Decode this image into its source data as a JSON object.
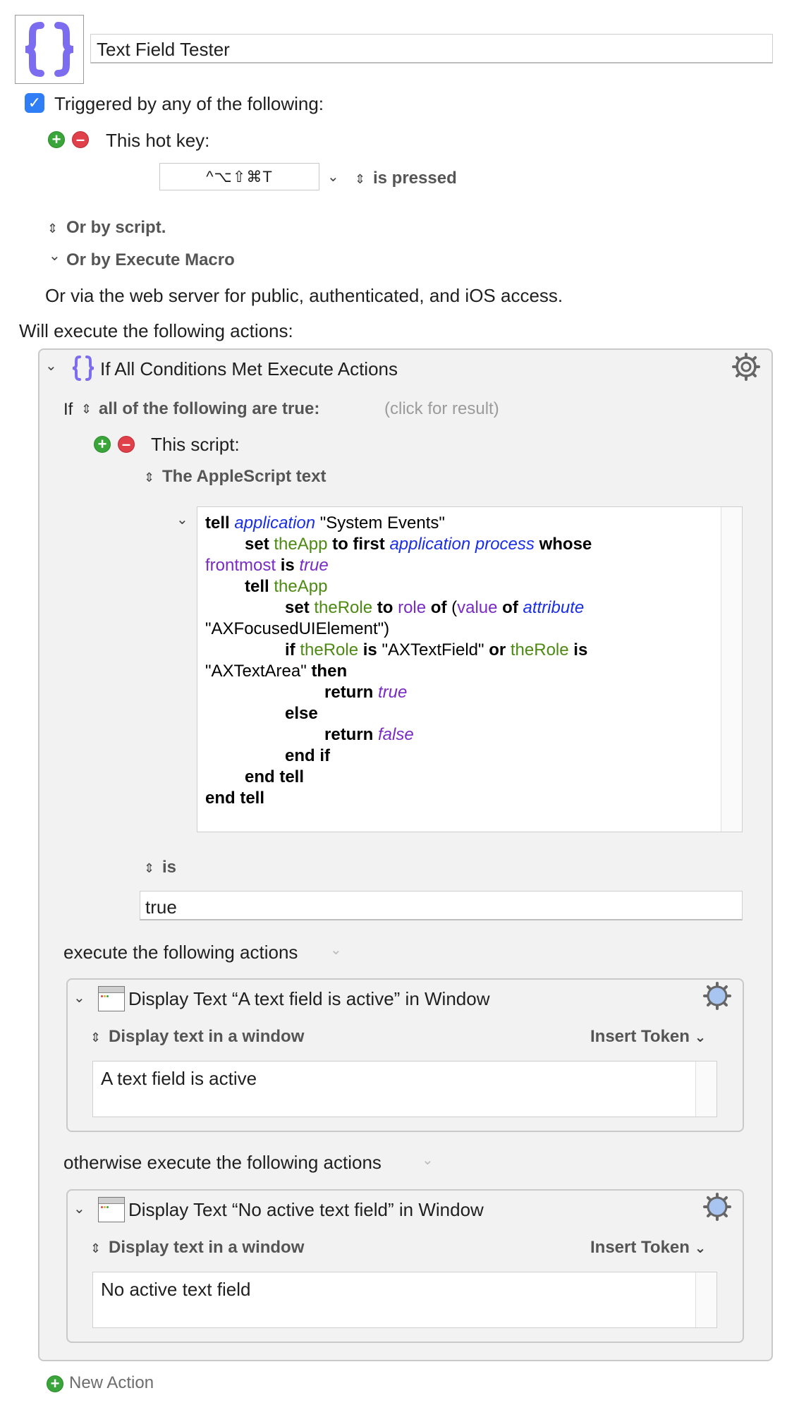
{
  "macro": {
    "title": "Text Field Tester",
    "icon": "curly-braces-icon"
  },
  "triggers": {
    "checkbox_label": "Triggered by any of the following:",
    "hotkey_label": "This hot key:",
    "hotkey_value": "^⌥⇧⌘T",
    "hotkey_condition": "is pressed",
    "or_by_script": "Or by script.",
    "or_by_execute_macro": "Or by Execute Macro",
    "web_server_note": "Or via the web server for public, authenticated, and iOS access."
  },
  "actions_header": "Will execute the following actions:",
  "if_action": {
    "title": "If All Conditions Met Execute Actions",
    "if_word": "If",
    "condition_mode": "all of the following are true:",
    "click_for_result": "(click for result)",
    "condition_label": "This script:",
    "script_type": "The AppleScript text",
    "comparison": "is",
    "comparison_value": "true",
    "then_label": "execute the following actions",
    "else_label": "otherwise execute the following actions"
  },
  "script": {
    "l1": [
      "tell",
      "application",
      "\"System Events\""
    ],
    "l2": [
      "set",
      "theApp",
      "to first",
      "application process",
      "whose"
    ],
    "l3": [
      "frontmost",
      "is",
      "true"
    ],
    "l4": [
      "tell",
      "theApp"
    ],
    "l5": [
      "set",
      "theRole",
      "to",
      "role",
      "of",
      "(",
      "value",
      "of",
      "attribute"
    ],
    "l6": [
      "\"AXFocusedUIElement\")"
    ],
    "l7": [
      "if",
      "theRole",
      "is",
      "\"AXTextField\"",
      "or",
      "theRole",
      "is"
    ],
    "l8": [
      "\"AXTextArea\"",
      "then"
    ],
    "l9": [
      "return",
      "true"
    ],
    "l10": [
      "else"
    ],
    "l11": [
      "return",
      "false"
    ],
    "l12": [
      "end if"
    ],
    "l13": [
      "end tell"
    ],
    "l14": [
      "end tell"
    ]
  },
  "then_action": {
    "title": "Display Text “A text field is active” in Window",
    "mode": "Display text in a window",
    "insert_token": "Insert Token",
    "text": "A text field is active"
  },
  "else_action": {
    "title": "Display Text “No active text field” in Window",
    "mode": "Display text in a window",
    "insert_token": "Insert Token",
    "text": "No active text field"
  },
  "new_action": "New Action",
  "colors": {
    "accent": "#2f7ef5",
    "add_green": "#3aa53a",
    "remove_red": "#e0404a",
    "icon_purple": "#7b6cf0",
    "keyword_blue": "#1a2ee6",
    "variable_green": "#4c8a12",
    "property_purple": "#7a2bc4"
  }
}
